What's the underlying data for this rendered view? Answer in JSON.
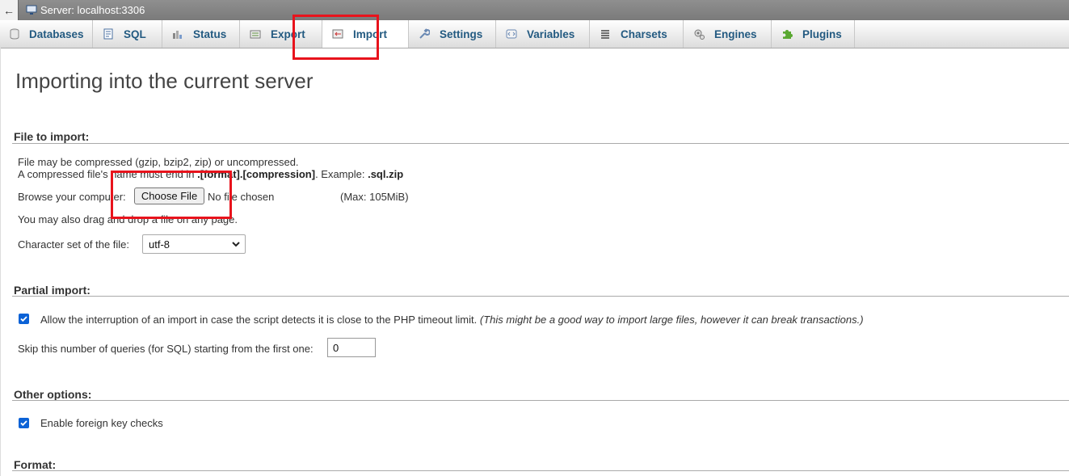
{
  "breadcrumb": {
    "back": "←",
    "server": "Server: localhost:3306"
  },
  "tabs": [
    {
      "label": "Databases",
      "icon": "database-icon"
    },
    {
      "label": "SQL",
      "icon": "sql-icon"
    },
    {
      "label": "Status",
      "icon": "status-icon"
    },
    {
      "label": "Export",
      "icon": "export-icon"
    },
    {
      "label": "Import",
      "icon": "import-icon",
      "active": true
    },
    {
      "label": "Settings",
      "icon": "wrench-icon"
    },
    {
      "label": "Variables",
      "icon": "variables-icon"
    },
    {
      "label": "Charsets",
      "icon": "charsets-icon"
    },
    {
      "label": "Engines",
      "icon": "engines-icon"
    },
    {
      "label": "Plugins",
      "icon": "puzzle-icon"
    }
  ],
  "page": {
    "title": "Importing into the current server"
  },
  "file_section": {
    "legend": "File to import:",
    "line1": "File may be compressed (gzip, bzip2, zip) or uncompressed.",
    "line2_prefix": "A compressed file's name must end in ",
    "line2_bold": ".[format].[compression]",
    "line2_mid": ". Example: ",
    "line2_example": ".sql.zip",
    "browse_label": "Browse your computer:",
    "choose_button": "Choose File",
    "no_file": "No file chosen",
    "max_size": "(Max: 105MiB)",
    "drag_hint": "You may also drag and drop a file on any page.",
    "charset_label": "Character set of the file:",
    "charset_value": "utf-8"
  },
  "partial_section": {
    "legend": "Partial import:",
    "allow_interrupt_label": "Allow the interruption of an import in case the script detects it is close to the PHP timeout limit.",
    "allow_interrupt_note": "(This might be a good way to import large files, however it can break transactions.)",
    "allow_interrupt_checked": true,
    "skip_label": "Skip this number of queries (for SQL) starting from the first one:",
    "skip_value": "0"
  },
  "other_section": {
    "legend": "Other options:",
    "fk_label": "Enable foreign key checks",
    "fk_checked": true
  },
  "format_section": {
    "legend": "Format:"
  },
  "colors": {
    "tab_text": "#235a81",
    "annotation": "#e8131c",
    "checkbox": "#0b62d6"
  }
}
